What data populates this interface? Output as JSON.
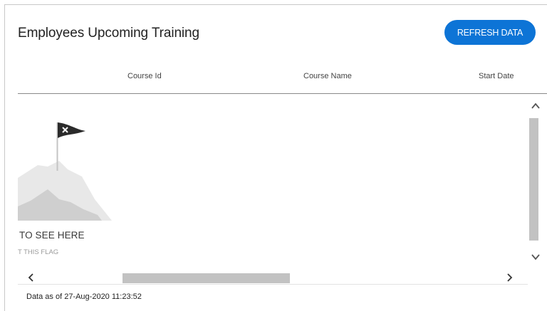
{
  "widget": {
    "title": "Employees Upcoming Training",
    "refresh_label": "REFRESH DATA"
  },
  "table": {
    "columns": [
      "Course Id",
      "Course Name",
      "Start Date"
    ]
  },
  "empty_state": {
    "title": "TO SEE HERE",
    "subtitle": "T THIS FLAG",
    "icon": "flag-on-mountain-icon"
  },
  "scrollbars": {
    "vertical_icons": [
      "chevron-up-icon",
      "chevron-down-icon"
    ],
    "horizontal_icons": [
      "chevron-left-icon",
      "chevron-right-icon"
    ]
  },
  "footer": {
    "status": "Data as of 27-Aug-2020 11:23:52"
  },
  "colors": {
    "accent": "#0d74d6",
    "scrollbar": "#c2c2c2",
    "illustration_light": "#e8e8e8",
    "illustration_dark": "#cfcfcf",
    "flag": "#2b2b2b"
  }
}
